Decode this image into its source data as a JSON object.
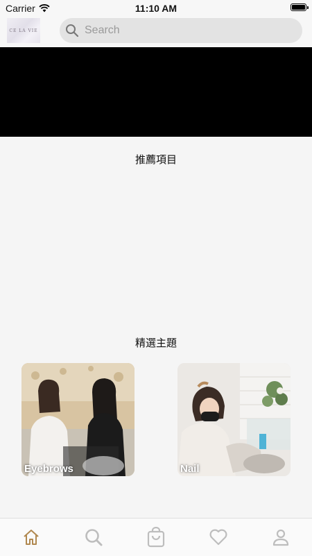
{
  "status_bar": {
    "carrier": "Carrier",
    "time": "11:10 AM"
  },
  "header": {
    "logo_text": "CE LA VIE",
    "search_placeholder": "Search"
  },
  "sections": {
    "recommended_title": "推薦項目",
    "featured_title": "精選主題"
  },
  "topics": [
    {
      "label": "Eyebrows"
    },
    {
      "label": "Nail"
    }
  ],
  "tab_bar": {
    "items": [
      {
        "icon": "home-icon",
        "active": true
      },
      {
        "icon": "search-icon",
        "active": false
      },
      {
        "icon": "shopping-bag-icon",
        "active": false
      },
      {
        "icon": "heart-icon",
        "active": false
      },
      {
        "icon": "profile-icon",
        "active": false
      }
    ],
    "active_color": "#b0884f",
    "inactive_color": "#bdbdbd"
  }
}
